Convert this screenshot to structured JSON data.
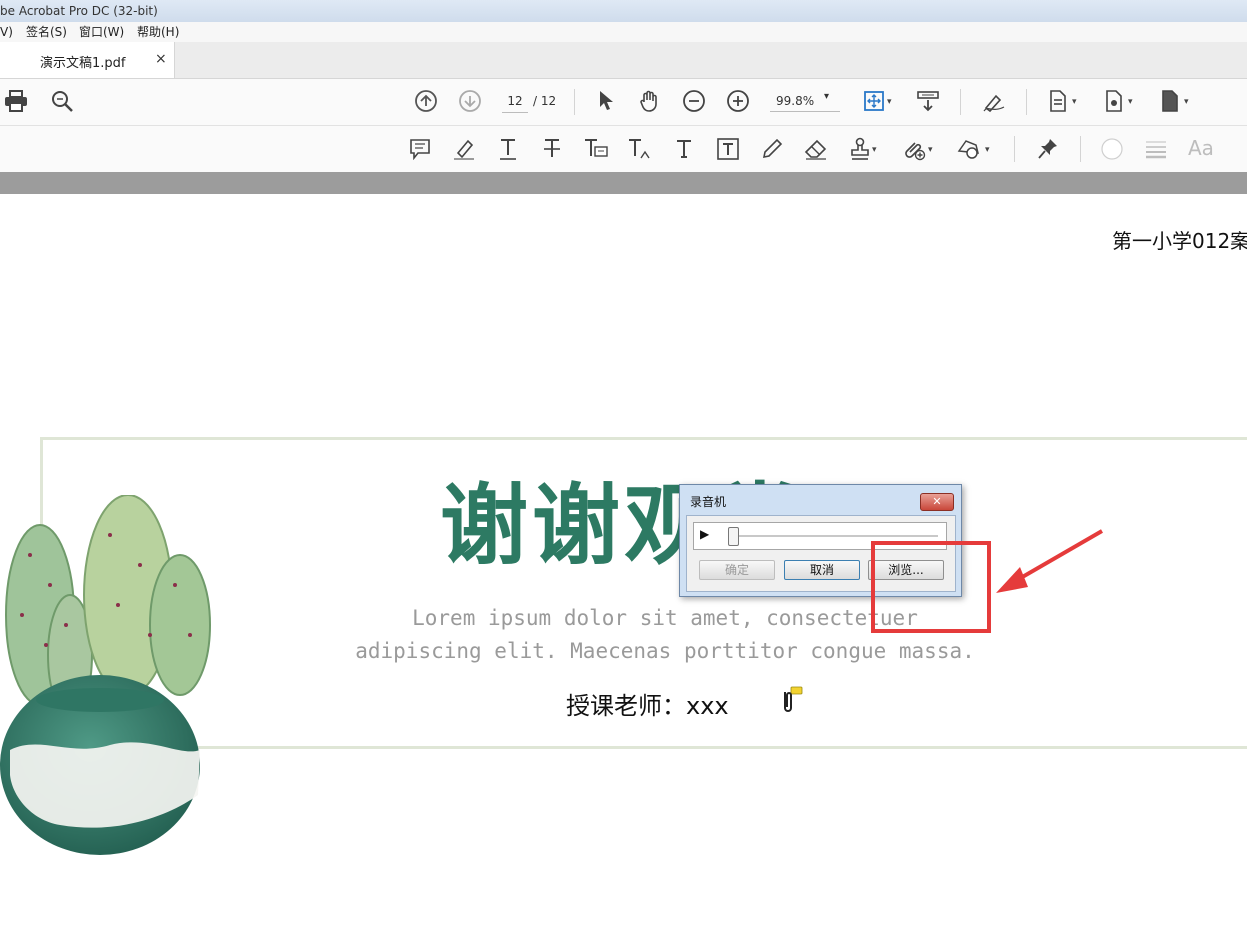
{
  "window": {
    "title": "be Acrobat Pro DC (32-bit)"
  },
  "menu": {
    "items": [
      "V)",
      "签名(S)",
      "窗口(W)",
      "帮助(H)"
    ]
  },
  "tab": {
    "label": "演示文稿1.pdf",
    "close": "×"
  },
  "toolbar": {
    "page_current": "12",
    "page_total": "/ 12",
    "zoom": "99.8%",
    "zoom_caret": "▾",
    "font_sample": "Aa"
  },
  "document": {
    "top_right_text": "第一小学012案",
    "title": "谢谢观赏",
    "lorem_line1": "Lorem ipsum dolor sit amet, consectetuer",
    "lorem_line2": "adipiscing elit. Maecenas porttitor congue massa.",
    "teacher": "授课老师：xxx"
  },
  "dialog": {
    "title": "录音机",
    "close": "✕",
    "play": "▶",
    "ok_label": "确定",
    "cancel_label": "取消",
    "browse_label": "浏览..."
  },
  "colors": {
    "title_green": "#2d7a63",
    "highlight_red": "#e53b3b"
  }
}
